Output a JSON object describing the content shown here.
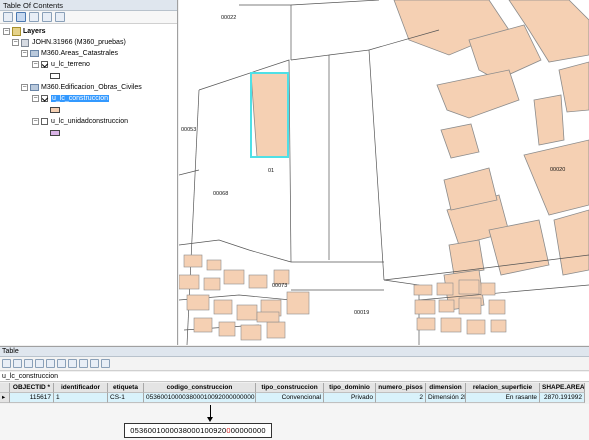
{
  "toc": {
    "title": "Table Of Contents",
    "root_label": "Layers",
    "db_label": "JOHN.31966 (M360_pruebas)",
    "group1_label": "M360.Areas_Catastrales",
    "layer1_label": "u_lc_terreno",
    "group2_label": "M360.Edificacion_Obras_Civiles",
    "layer2_label": "u_lc_construccion",
    "layer3_label": "u_lc_unidadconstruccion"
  },
  "map": {
    "labels": {
      "l00022": "00022",
      "l00053": "00053",
      "l00068": "00068",
      "l00020": "00020",
      "l00073": "00073",
      "l00019": "00019",
      "ldot": "01"
    },
    "colors": {
      "parcel": "#f5d0b3",
      "parcel_stroke": "#8c8c8c",
      "selection": "#4fe0e6",
      "line": "#555555"
    }
  },
  "table": {
    "title": "Table",
    "tab_name": "u_lc_construccion",
    "columns": [
      "OBJECTID *",
      "identificador",
      "etiqueta",
      "codigo_construccion",
      "tipo_construccion",
      "tipo_dominio",
      "numero_pisos",
      "dimension",
      "relacion_superficie",
      "SHAPE.AREA"
    ],
    "row": [
      "115617",
      "1",
      "CS-1",
      "053600100003800010092000000000",
      "Convencional",
      "Privado",
      "2",
      "Dimensión 2D",
      "En rasante",
      "2870.191992"
    ]
  },
  "callout": {
    "part1": "0536001000038000100920",
    "part2": "0",
    "part3": "00000000",
    "highlight_color": "#d62020"
  }
}
